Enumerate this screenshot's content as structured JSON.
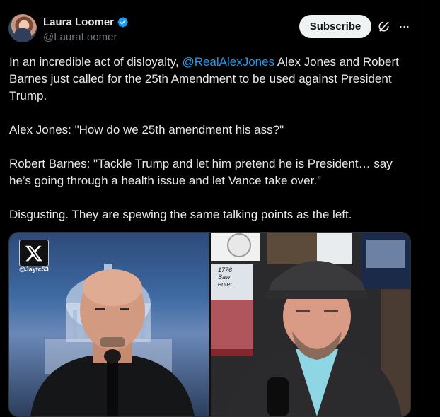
{
  "author": {
    "display_name": "Laura Loomer",
    "handle": "@LauraLoomer",
    "verified_color": "#1d9bf0"
  },
  "actions": {
    "subscribe_label": "Subscribe",
    "grok_icon": "grok-icon",
    "more_icon": "more-icon"
  },
  "tweet": {
    "p1_before": "In an incredible act of disloyalty, ",
    "p1_mention": "@RealAlexJones",
    "p1_after": " Alex Jones and Robert Barnes just called for the 25th Amendment to be used against President Trump.",
    "p2": "Alex Jones: \"How do we 25th amendment his ass?\"",
    "p3": "Robert Barnes: \"Tackle Trump and let him pretend he is President… say he’s going through a health issue and let Vance take over.”",
    "p4": "Disgusting. They are spewing the same talking points as the left."
  },
  "media": {
    "watermark": "@Jaytc53",
    "logo": "x-logo-icon",
    "sign_text_line1": "1776",
    "sign_text_line2": "Saw",
    "sign_text_line3": "enter"
  },
  "colors": {
    "background": "#000000",
    "text": "#e7e9ea",
    "muted": "#71767b",
    "link": "#1d9bf0"
  }
}
